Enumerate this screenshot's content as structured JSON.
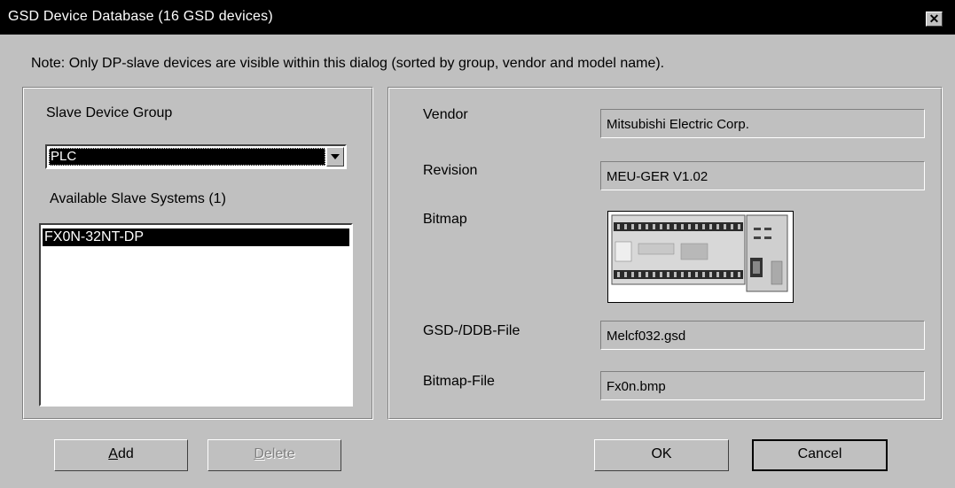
{
  "window": {
    "title": "GSD Device Database (16 GSD devices)",
    "close_glyph": "✕"
  },
  "note": "Note: Only DP-slave devices are visible within this dialog (sorted by group, vendor and model name).",
  "left_panel": {
    "group_label": "Slave Device Group",
    "group_value": "PLC",
    "available_label": "Available Slave Systems (1)",
    "systems": [
      "FX0N-32NT-DP"
    ]
  },
  "right_panel": {
    "vendor_label": "Vendor",
    "vendor_value": "Mitsubishi Electric Corp.",
    "revision_label": "Revision",
    "revision_value": "MEU-GER V1.02",
    "bitmap_label": "Bitmap",
    "gsd_label": "GSD-/DDB-File",
    "gsd_value": "Melcf032.gsd",
    "bitmapfile_label": "Bitmap-File",
    "bitmapfile_value": "Fx0n.bmp"
  },
  "buttons": {
    "add_mnemonic": "A",
    "add_rest": "dd",
    "delete_mnemonic": "D",
    "delete_rest": "elete",
    "ok": "OK",
    "cancel": "Cancel"
  },
  "colors": {
    "dialog_bg": "#c0c0c0",
    "titlebar_bg": "#000000",
    "selection_bg": "#000000"
  }
}
